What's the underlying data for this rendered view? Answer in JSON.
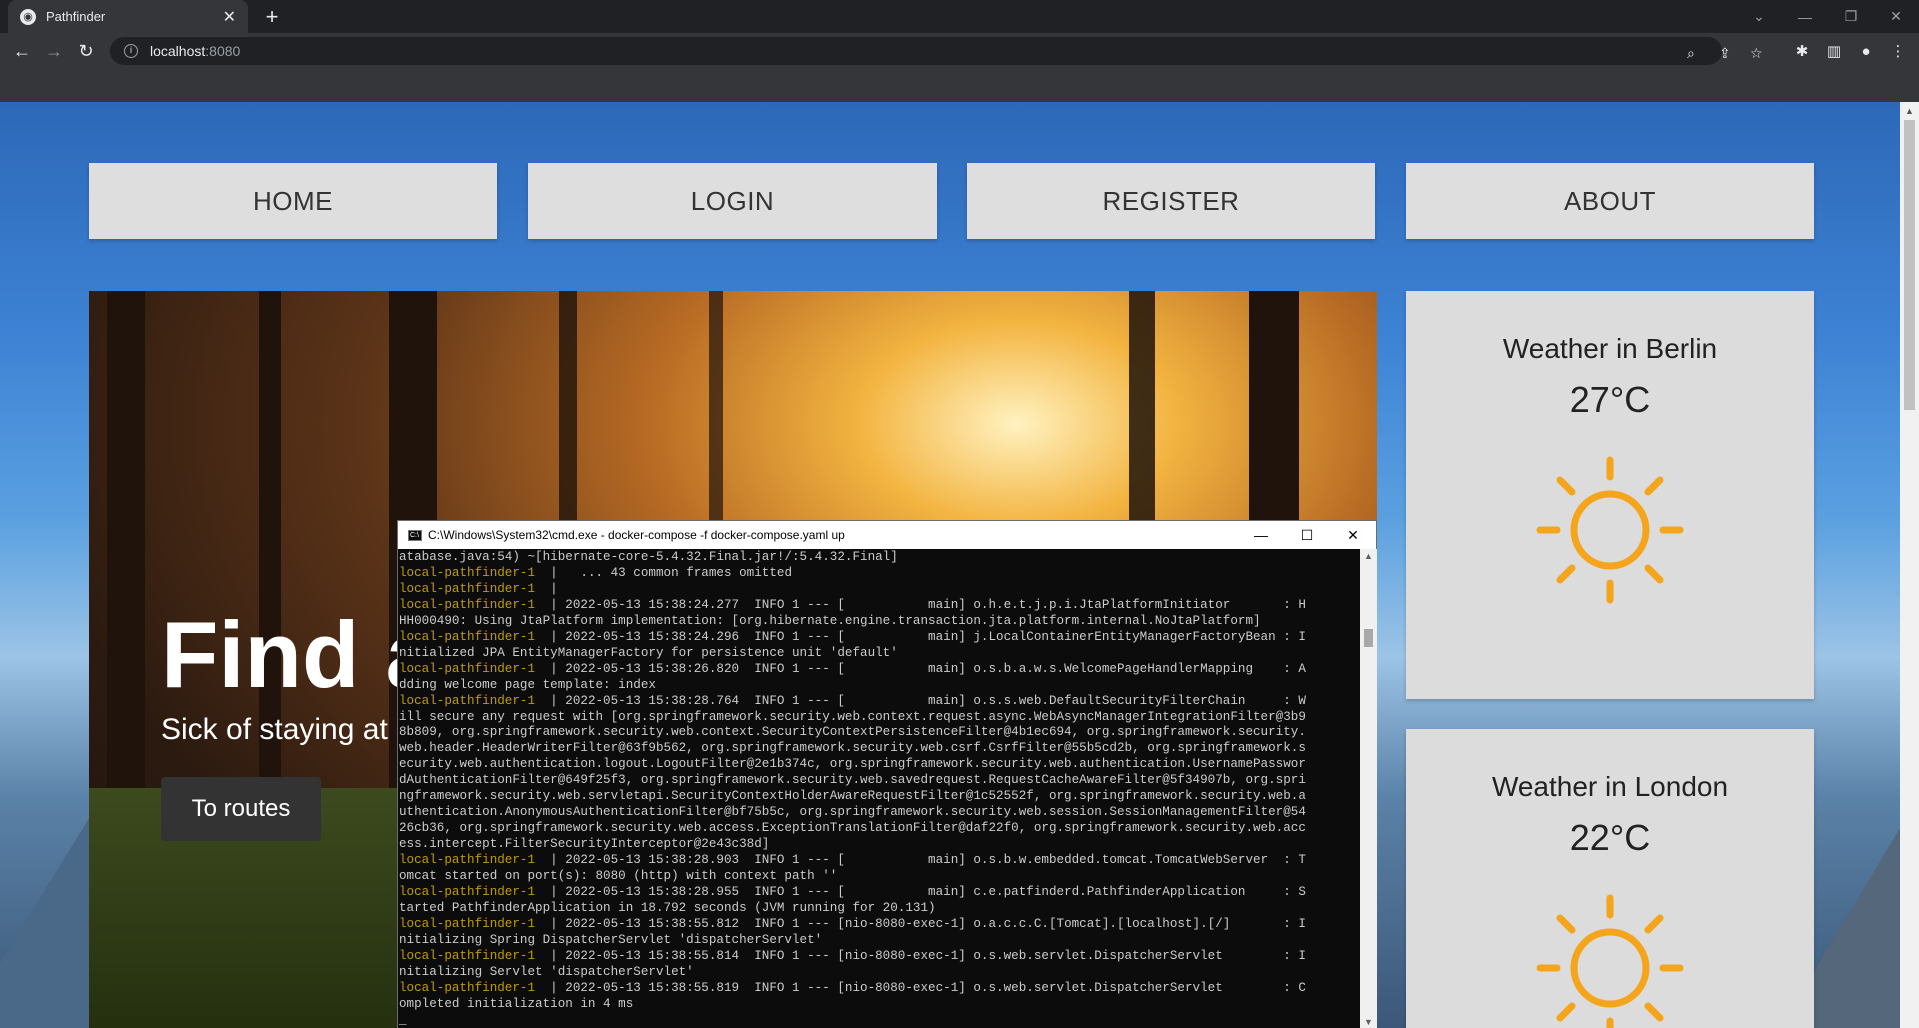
{
  "browser": {
    "tab_title": "Pathfinder",
    "tab_close": "✕",
    "new_tab": "+",
    "url_host": "localhost",
    "url_port": ":8080",
    "icons": [
      "back-icon",
      "forward-icon",
      "reload-icon",
      "zoom-icon",
      "share-icon",
      "bookmark-star-icon",
      "extensions-icon",
      "sidebar-icon",
      "profile-icon",
      "menu-icon"
    ]
  },
  "nav": {
    "home": "HOME",
    "login": "LOGIN",
    "register": "REGISTER",
    "about": "ABOUT"
  },
  "hero": {
    "title": "Find a",
    "subtitle": "Sick of staying at",
    "button": "To routes"
  },
  "weather": [
    {
      "city": "Weather in Berlin",
      "temp": "27°C",
      "icon": "sun-icon"
    },
    {
      "city": "Weather in London",
      "temp": "22°C",
      "icon": "sun-icon"
    }
  ],
  "cmd": {
    "title": "C:\\Windows\\System32\\cmd.exe - docker-compose  -f docker-compose.yaml up",
    "minimize": "—",
    "maximize": "☐",
    "close": "✕",
    "lines": [
      {
        "p": "",
        "t": "atabase.java:54) ~[hibernate-core-5.4.32.Final.jar!/:5.4.32.Final]"
      },
      {
        "p": "local-pathfinder-1  ",
        "t": "|   ... 43 common frames omitted"
      },
      {
        "p": "local-pathfinder-1  ",
        "t": "|"
      },
      {
        "p": "local-pathfinder-1  ",
        "t": "| 2022-05-13 15:38:24.277  INFO 1 --- [           main] o.h.e.t.j.p.i.JtaPlatformInitiator       : H"
      },
      {
        "p": "",
        "t": "HH000490: Using JtaPlatform implementation: [org.hibernate.engine.transaction.jta.platform.internal.NoJtaPlatform]"
      },
      {
        "p": "local-pathfinder-1  ",
        "t": "| 2022-05-13 15:38:24.296  INFO 1 --- [           main] j.LocalContainerEntityManagerFactoryBean : I"
      },
      {
        "p": "",
        "t": "nitialized JPA EntityManagerFactory for persistence unit 'default'"
      },
      {
        "p": "local-pathfinder-1  ",
        "t": "| 2022-05-13 15:38:26.820  INFO 1 --- [           main] o.s.b.a.w.s.WelcomePageHandlerMapping    : A"
      },
      {
        "p": "",
        "t": "dding welcome page template: index"
      },
      {
        "p": "local-pathfinder-1  ",
        "t": "| 2022-05-13 15:38:28.764  INFO 1 --- [           main] o.s.s.web.DefaultSecurityFilterChain     : W"
      },
      {
        "p": "",
        "t": "ill secure any request with [org.springframework.security.web.context.request.async.WebAsyncManagerIntegrationFilter@3b9"
      },
      {
        "p": "",
        "t": "8b809, org.springframework.security.web.context.SecurityContextPersistenceFilter@4b1ec694, org.springframework.security."
      },
      {
        "p": "",
        "t": "web.header.HeaderWriterFilter@63f9b562, org.springframework.security.web.csrf.CsrfFilter@55b5cd2b, org.springframework.s"
      },
      {
        "p": "",
        "t": "ecurity.web.authentication.logout.LogoutFilter@2e1b374c, org.springframework.security.web.authentication.UsernamePasswor"
      },
      {
        "p": "",
        "t": "dAuthenticationFilter@649f25f3, org.springframework.security.web.savedrequest.RequestCacheAwareFilter@5f34907b, org.spri"
      },
      {
        "p": "",
        "t": "ngframework.security.web.servletapi.SecurityContextHolderAwareRequestFilter@1c52552f, org.springframework.security.web.a"
      },
      {
        "p": "",
        "t": "uthentication.AnonymousAuthenticationFilter@bf75b5c, org.springframework.security.web.session.SessionManagementFilter@54"
      },
      {
        "p": "",
        "t": "26cb36, org.springframework.security.web.access.ExceptionTranslationFilter@daf22f0, org.springframework.security.web.acc"
      },
      {
        "p": "",
        "t": "ess.intercept.FilterSecurityInterceptor@2e43c38d]"
      },
      {
        "p": "local-pathfinder-1  ",
        "t": "| 2022-05-13 15:38:28.903  INFO 1 --- [           main] o.s.b.w.embedded.tomcat.TomcatWebServer  : T"
      },
      {
        "p": "",
        "t": "omcat started on port(s): 8080 (http) with context path ''"
      },
      {
        "p": "local-pathfinder-1  ",
        "t": "| 2022-05-13 15:38:28.955  INFO 1 --- [           main] c.e.patfinderd.PathfinderApplication     : S"
      },
      {
        "p": "",
        "t": "tarted PathfinderApplication in 18.792 seconds (JVM running for 20.131)"
      },
      {
        "p": "local-pathfinder-1  ",
        "t": "| 2022-05-13 15:38:55.812  INFO 1 --- [nio-8080-exec-1] o.a.c.c.C.[Tomcat].[localhost].[/]       : I"
      },
      {
        "p": "",
        "t": "nitializing Spring DispatcherServlet 'dispatcherServlet'"
      },
      {
        "p": "local-pathfinder-1  ",
        "t": "| 2022-05-13 15:38:55.814  INFO 1 --- [nio-8080-exec-1] o.s.web.servlet.DispatcherServlet        : I"
      },
      {
        "p": "",
        "t": "nitializing Servlet 'dispatcherServlet'"
      },
      {
        "p": "local-pathfinder-1  ",
        "t": "| 2022-05-13 15:38:55.819  INFO 1 --- [nio-8080-exec-1] o.s.web.servlet.DispatcherServlet        : C"
      },
      {
        "p": "",
        "t": "ompleted initialization in 4 ms"
      },
      {
        "p": "",
        "t": "_"
      }
    ]
  },
  "colors": {
    "nav_bg": "#dedede",
    "log_prefix": "#c19c00",
    "sun": "#f5a51b"
  }
}
